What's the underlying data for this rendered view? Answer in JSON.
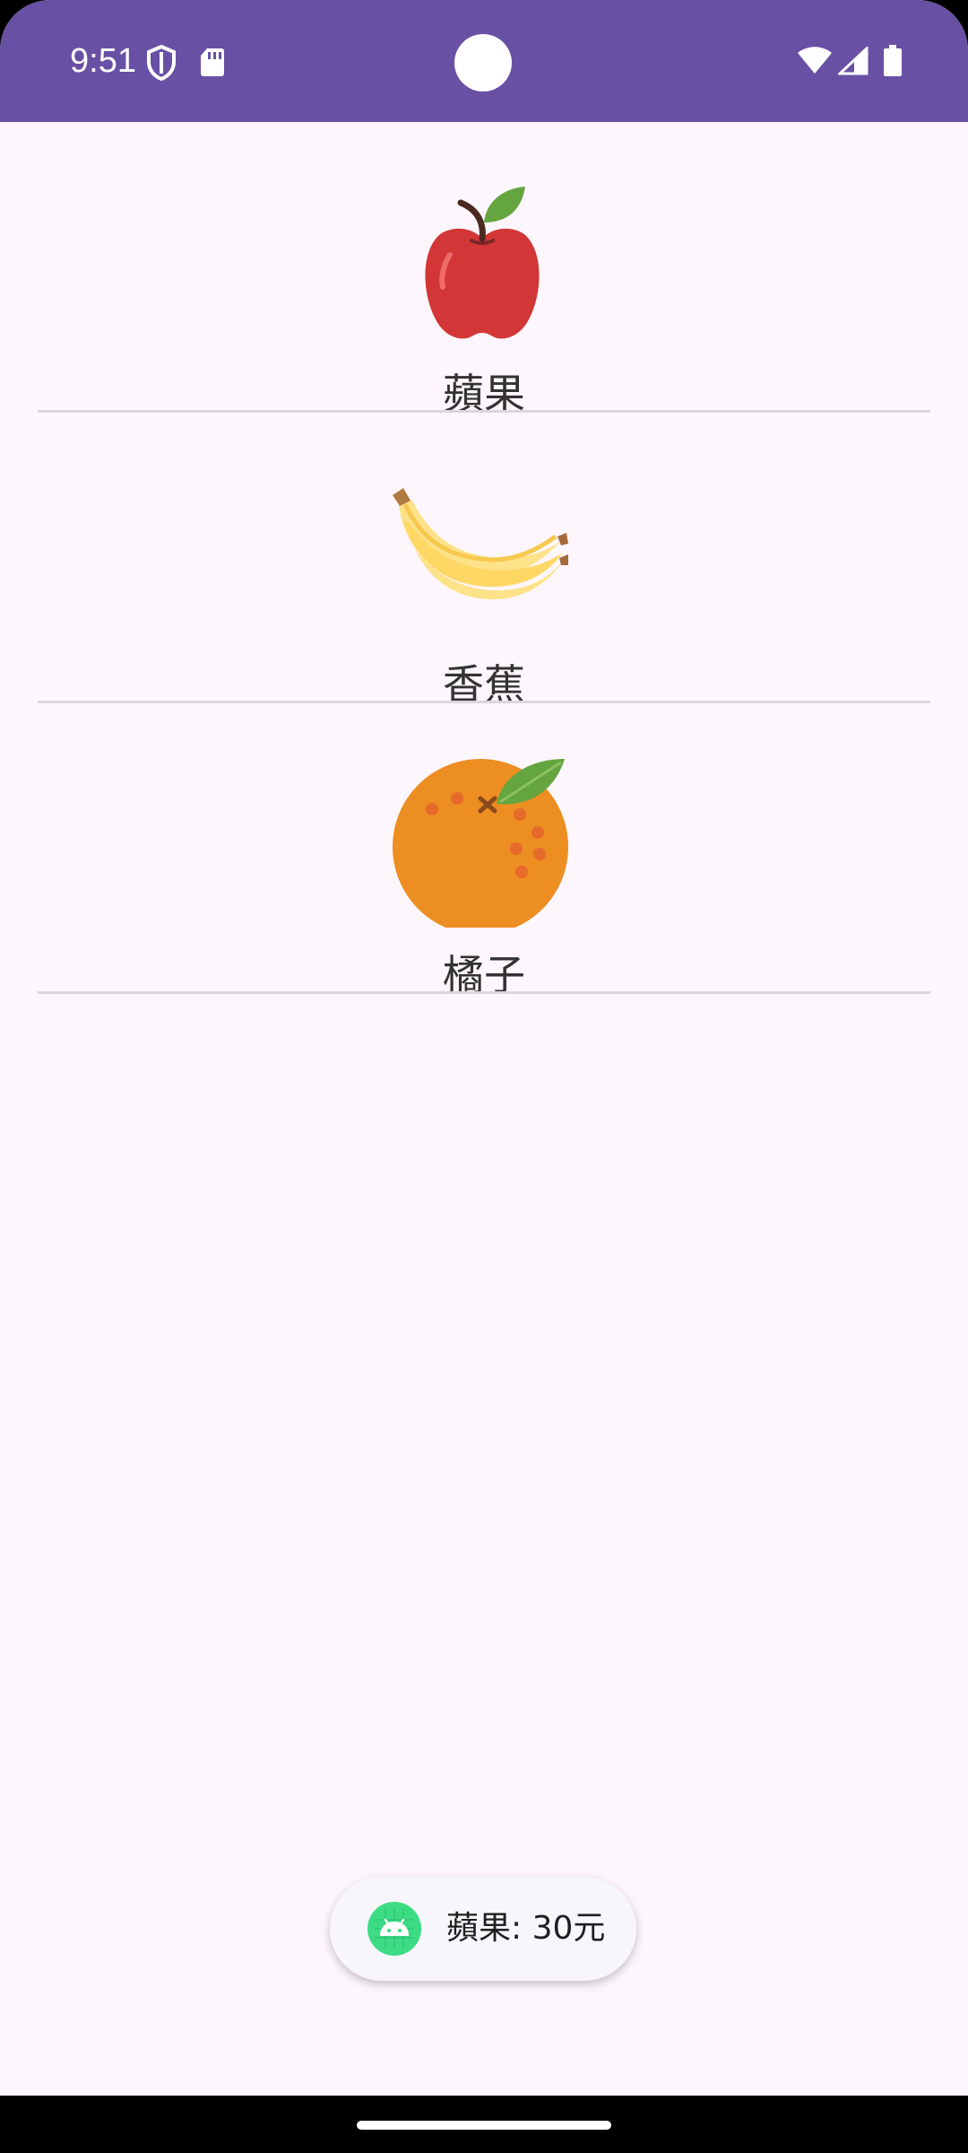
{
  "status_bar": {
    "time": "9:51",
    "icons": [
      "shield-icon",
      "sd-card-icon",
      "wifi-icon",
      "cell-signal-icon",
      "battery-icon"
    ],
    "background_color": "#6851a4"
  },
  "fruit_list": {
    "items": [
      {
        "name": "蘋果",
        "icon": "apple-image"
      },
      {
        "name": "香蕉",
        "icon": "banana-image"
      },
      {
        "name": "橘子",
        "icon": "orange-image"
      }
    ]
  },
  "toast": {
    "icon": "android-icon",
    "message": "蘋果: 30元"
  },
  "colors": {
    "background": "#fdf6fc",
    "divider": "#dcd6dc"
  }
}
